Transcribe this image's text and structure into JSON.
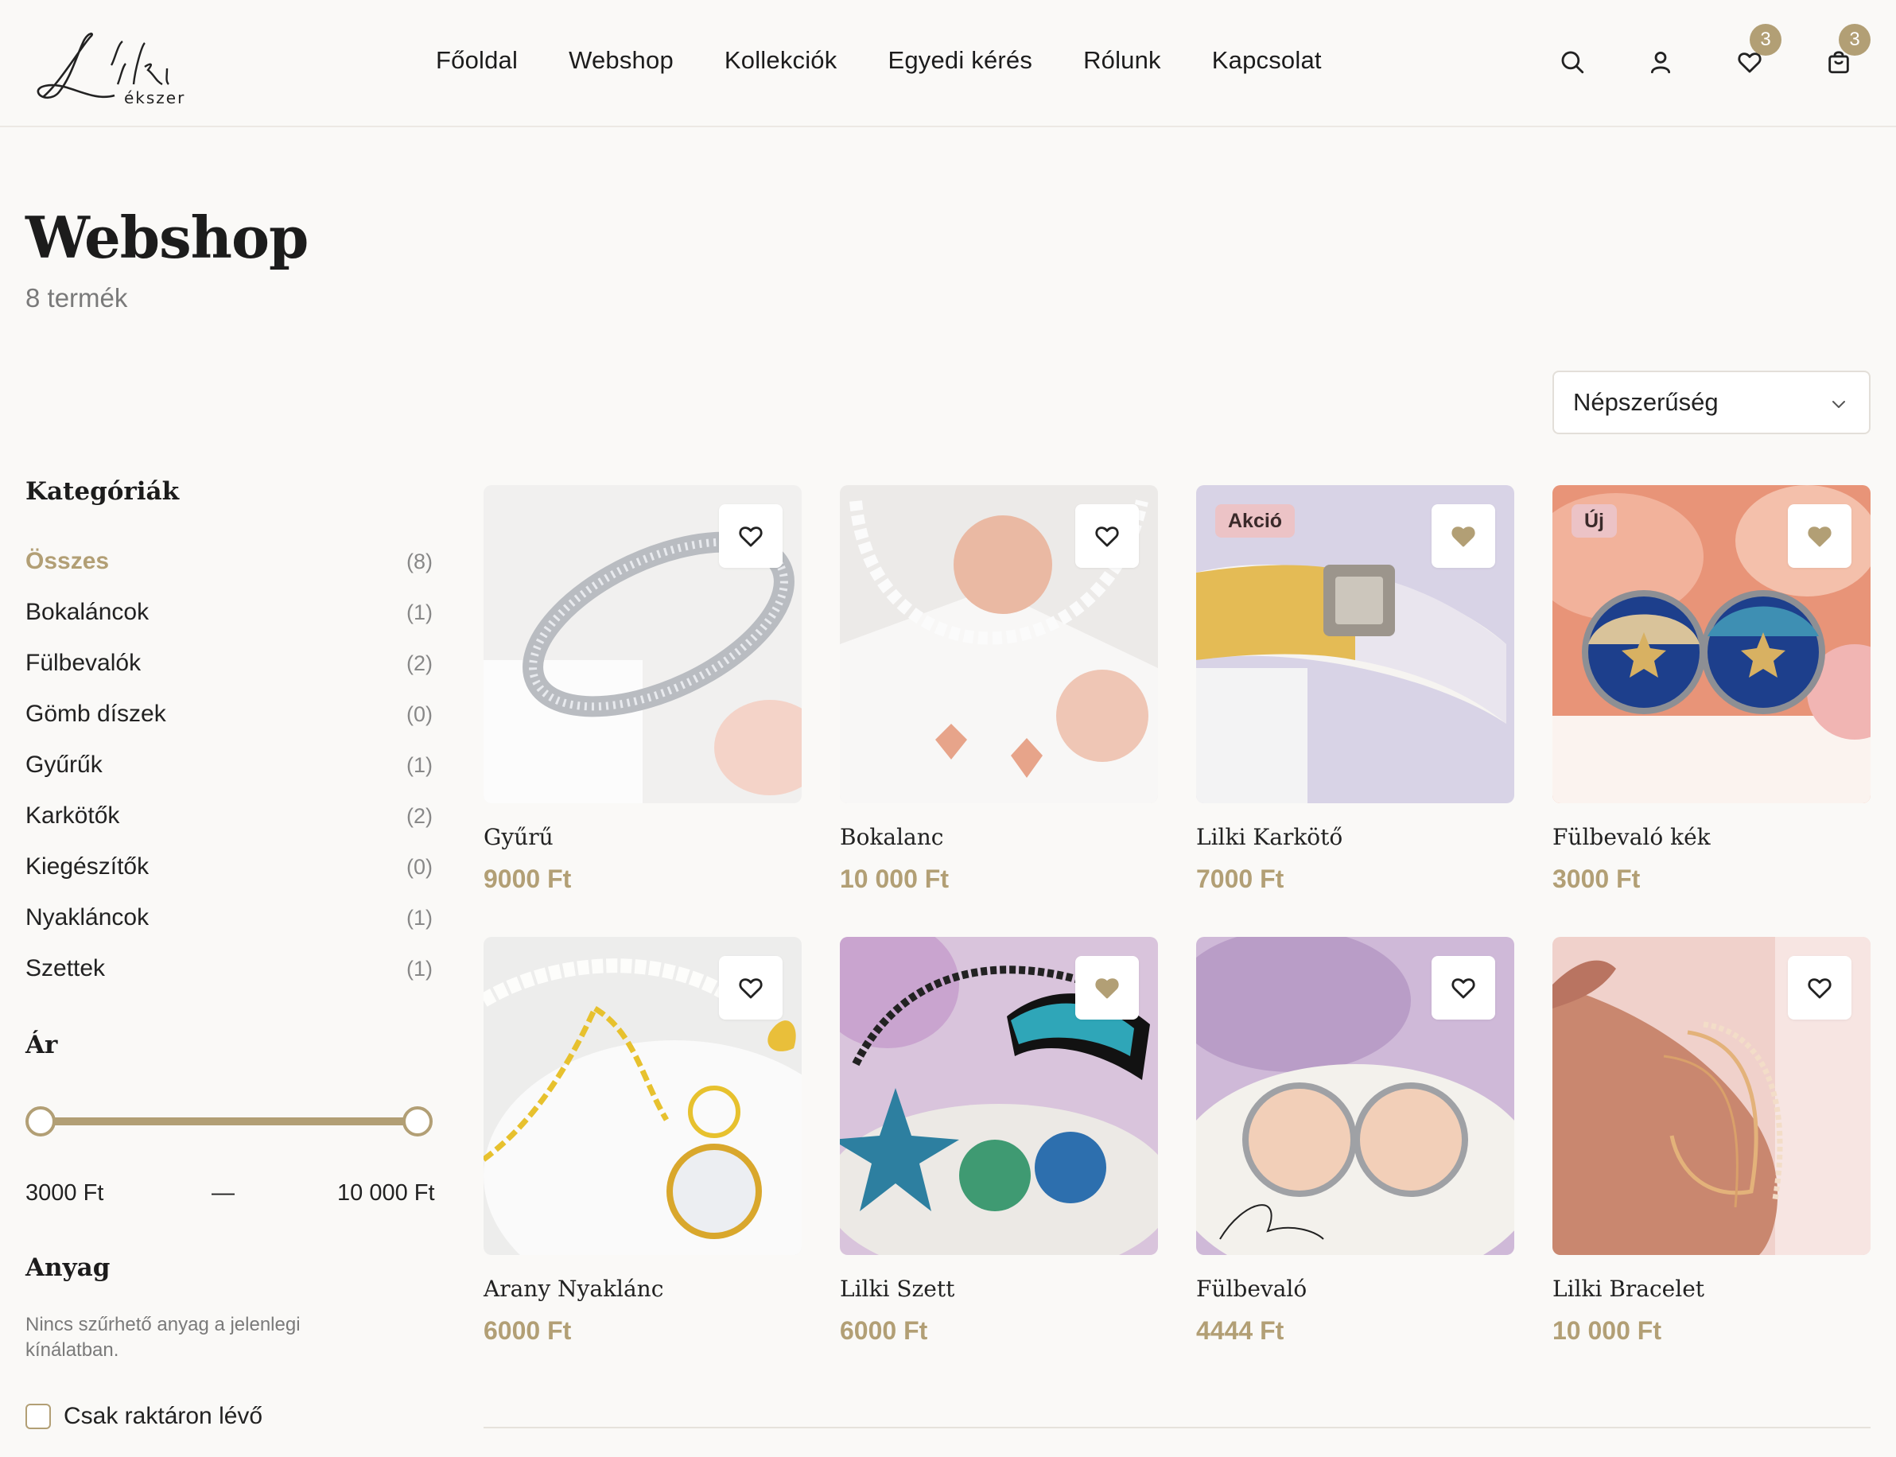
{
  "brand": {
    "logo_main": "Lilki",
    "logo_sub": "ékszer",
    "accent": "#b29f75"
  },
  "nav": {
    "items": [
      "Főoldal",
      "Webshop",
      "Kollekciók",
      "Egyedi kérés",
      "Rólunk",
      "Kapcsolat"
    ]
  },
  "header_icons": {
    "search": "search-icon",
    "account": "user-icon",
    "wishlist": "heart-icon",
    "wishlist_count": "3",
    "cart": "shopping-bag-icon",
    "cart_count": "3"
  },
  "page": {
    "title": "Webshop",
    "count": "8 termék"
  },
  "sort": {
    "selected": "Népszerűség"
  },
  "sidebar": {
    "categories_heading": "Kategóriák",
    "categories": [
      {
        "name": "Összes",
        "count": "(8)",
        "active": true
      },
      {
        "name": "Bokaláncok",
        "count": "(1)"
      },
      {
        "name": "Fülbevalók",
        "count": "(2)"
      },
      {
        "name": "Gömb díszek",
        "count": "(0)"
      },
      {
        "name": "Gyűrűk",
        "count": "(1)"
      },
      {
        "name": "Karkötők",
        "count": "(2)"
      },
      {
        "name": "Kiegészítők",
        "count": "(0)"
      },
      {
        "name": "Nyakláncok",
        "count": "(1)"
      },
      {
        "name": "Szettek",
        "count": "(1)"
      }
    ],
    "price_heading": "Ár",
    "price_min": "3000 Ft",
    "price_dash": "—",
    "price_max": "10 000 Ft",
    "material_heading": "Anyag",
    "material_note": "Nincs szűrhető anyag a jelenlegi kínálatban.",
    "in_stock_label": "Csak raktáron lévő"
  },
  "products": [
    {
      "name": "Gyűrű",
      "price": "9000 Ft",
      "tag": "",
      "favorited": false
    },
    {
      "name": "Bokalanc",
      "price": "10 000 Ft",
      "tag": "",
      "favorited": false
    },
    {
      "name": "Lilki Karkötő",
      "price": "7000 Ft",
      "tag": "Akció",
      "favorited": true
    },
    {
      "name": "Fülbevaló kék",
      "price": "3000 Ft",
      "tag": "Új",
      "favorited": true
    },
    {
      "name": "Arany Nyaklánc",
      "price": "6000 Ft",
      "tag": "",
      "favorited": false
    },
    {
      "name": "Lilki Szett",
      "price": "6000 Ft",
      "tag": "",
      "favorited": true
    },
    {
      "name": "Fülbevaló",
      "price": "4444 Ft",
      "tag": "",
      "favorited": false
    },
    {
      "name": "Lilki Bracelet",
      "price": "10 000 Ft",
      "tag": "",
      "favorited": false
    }
  ]
}
